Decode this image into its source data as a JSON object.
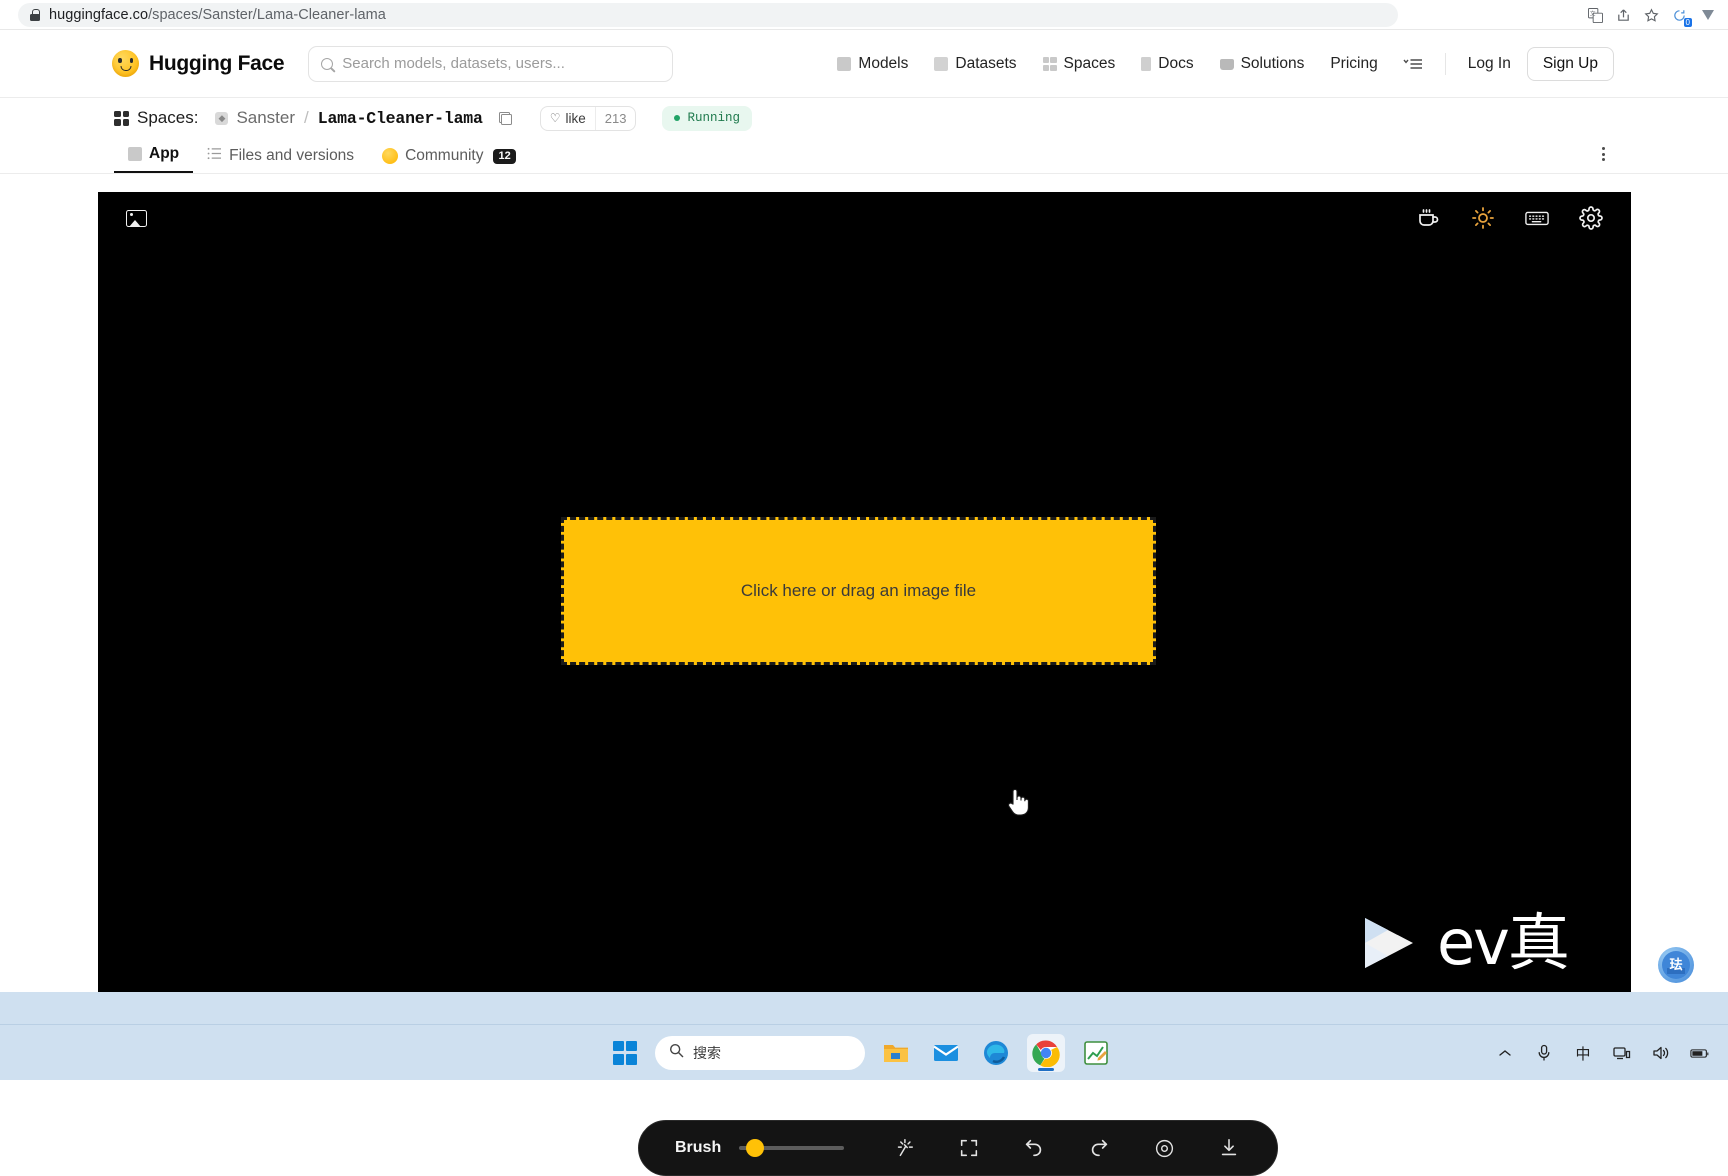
{
  "browser": {
    "url_prefix": "huggingface.co",
    "url_path": "/spaces/Sanster/Lama-Cleaner-lama",
    "lock_icon": "lock-icon",
    "toolbar_icons": [
      {
        "name": "translate-icon",
        "glyph": "⎙"
      },
      {
        "name": "share-icon",
        "glyph": "↪"
      },
      {
        "name": "bookmark-star-icon",
        "glyph": "☆"
      },
      {
        "name": "sync-icon",
        "glyph": "⟳"
      },
      {
        "name": "extension-v-icon",
        "glyph": "▼"
      }
    ],
    "sync_badge": "0"
  },
  "header": {
    "brand": "Hugging Face",
    "brand_icon": "hugging-face-emoji-icon",
    "search": {
      "icon": "search-icon",
      "placeholder": "Search models, datasets, users..."
    },
    "nav": [
      {
        "label": "Models",
        "icon": "cube-icon"
      },
      {
        "label": "Datasets",
        "icon": "database-icon"
      },
      {
        "label": "Spaces",
        "icon": "grid-icon"
      },
      {
        "label": "Docs",
        "icon": "document-icon"
      },
      {
        "label": "Solutions",
        "icon": "briefcase-icon"
      },
      {
        "label": "Pricing",
        "icon": ""
      }
    ],
    "menu_icon": "hamburger-menu-icon",
    "login_label": "Log In",
    "signup_label": "Sign Up"
  },
  "spaces_bar": {
    "grid_icon": "spaces-grid-icon",
    "label": "Spaces:",
    "owner": "Sanster",
    "separator": "/",
    "repo": "Lama-Cleaner-lama",
    "copy_icon": "copy-icon",
    "like": {
      "heart_icon": "heart-icon",
      "label": "like",
      "count": "213"
    },
    "status": {
      "label": "Running",
      "dot_color": "#21a366",
      "bg_color": "#e8f7ef",
      "text_color": "#1f7a4d"
    }
  },
  "tabs": [
    {
      "label": "App",
      "icon": "cube-icon",
      "active": true,
      "badge": ""
    },
    {
      "label": "Files and versions",
      "icon": "files-icon",
      "active": false,
      "badge": ""
    },
    {
      "label": "Community",
      "icon": "hugging-face-emoji-icon",
      "active": false,
      "badge": "12"
    }
  ],
  "kebab_icon": "more-options-icon",
  "app": {
    "background": "#000000",
    "topbar": {
      "left_icon": "image-icon",
      "tools": [
        {
          "name": "coffee-icon",
          "color": "#f0f0f0"
        },
        {
          "name": "brightness-sun-icon",
          "color": "#e8a33d"
        },
        {
          "name": "keyboard-shortcuts-icon",
          "color": "#f0f0f0"
        },
        {
          "name": "settings-gear-icon",
          "color": "#f0f0f0"
        }
      ]
    },
    "dropzone": {
      "text": "Click here or drag an image file",
      "fill_color": "#FFC107",
      "border_style": "dashed",
      "border_color": "#1a1a1a"
    },
    "cursor_icon": "pointer-hand-cursor",
    "bottom_toolbar": {
      "brush_label": "Brush",
      "slider_value_pct": 13,
      "accent_color": "#FFC107",
      "icons": [
        {
          "name": "magic-wand-icon"
        },
        {
          "name": "fullscreen-expand-icon"
        },
        {
          "name": "undo-icon"
        },
        {
          "name": "redo-icon"
        },
        {
          "name": "eye-preview-icon"
        },
        {
          "name": "download-icon"
        }
      ]
    }
  },
  "watermark": {
    "play_icon": "ev-play-logo-icon",
    "text": "ev真",
    "globe_icon": "globe-badge-icon"
  },
  "taskbar": {
    "start_icon": "windows-start-icon",
    "search": {
      "icon": "search-icon",
      "text": "搜索"
    },
    "apps": [
      {
        "name": "file-explorer-icon",
        "active": false
      },
      {
        "name": "mail-icon",
        "active": false
      },
      {
        "name": "microsoft-edge-icon",
        "active": false
      },
      {
        "name": "google-chrome-icon",
        "active": true
      },
      {
        "name": "chart-editor-icon",
        "active": false
      }
    ],
    "tray": [
      {
        "name": "show-hidden-icons-chevron",
        "glyph": "⌃"
      },
      {
        "name": "microphone-icon",
        "glyph": "🎤"
      },
      {
        "name": "ime-chinese-indicator",
        "glyph": "中"
      },
      {
        "name": "network-icon",
        "glyph": "🖧"
      },
      {
        "name": "volume-icon",
        "glyph": "🔊"
      },
      {
        "name": "battery-icon",
        "glyph": "🔋"
      }
    ]
  }
}
